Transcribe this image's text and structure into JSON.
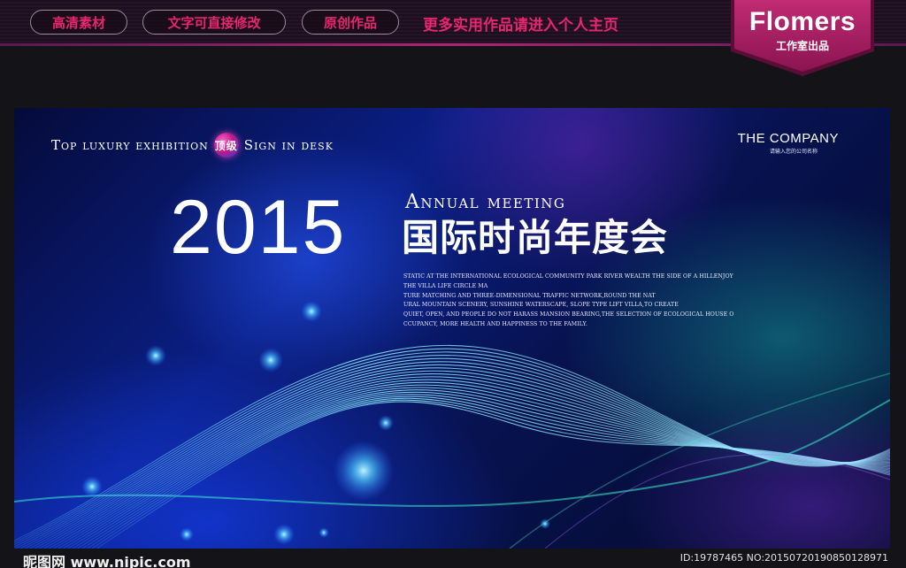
{
  "top_banner": {
    "pills": [
      "高清素材",
      "文字可直接修改",
      "原创作品"
    ],
    "more_link": "更多实用作品请进入个人主页",
    "badge": {
      "title": "Flomers",
      "subtitle": "工作室出品"
    }
  },
  "poster": {
    "tagline_before": "Top luxury exhibition",
    "tagline_badge": "顶级",
    "tagline_after": "Sign in desk",
    "company": "THE COMPANY",
    "company_sub": "请输入您的公司名称",
    "year": "2015",
    "annual": "Annual meeting",
    "cn_title": "国际时尚年度会",
    "description": [
      "STATIC AT THE INTERNATIONAL ECOLOGICAL COMMUNITY PARK RIVER WEALTH THE SIDE OF A HILLENJOY",
      "THE VILLA LIFE CIRCLE MA",
      "TURE MATCHING AND THREE-DIMENSIONAL TRAFFIC NETWORK,ROUND THE NAT",
      "URAL MOUNTAIN SCENERY, SUNSHINE WATERSCAPE, SLOPE TYPE LIFT VILLA,TO CREATE",
      "QUIET, OPEN, AND PEOPLE DO NOT HARASS MANSION BEARING,THE SELECTION OF ECOLOGICAL HOUSE O",
      "CCUPANCY, MORE HEALTH AND HAPPINESS TO THE FAMILY."
    ],
    "colors": {
      "accent_pink": "#e8266e",
      "background_blue": "#0b1f86",
      "line_cyan": "#7fe6ff"
    }
  },
  "footer": {
    "watermark": "昵图网 www.nipic.com",
    "id_line": "ID:19787465 NO:20150720190850128971"
  }
}
